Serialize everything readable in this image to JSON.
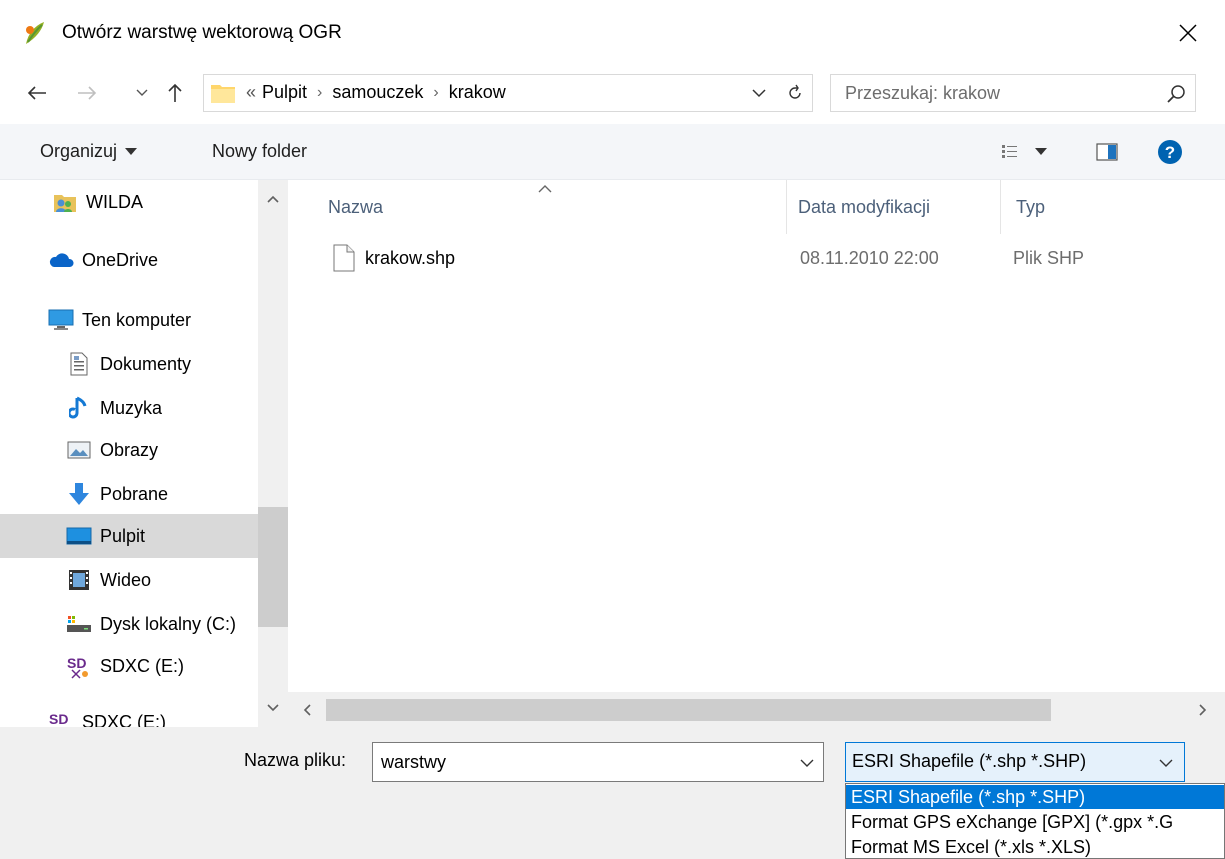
{
  "window": {
    "title": "Otwórz warstwę wektorową OGR",
    "close_icon": "close-icon"
  },
  "nav": {
    "back_icon": "back-arrow-icon",
    "forward_icon": "forward-arrow-icon",
    "recent_icon": "chevron-down-icon",
    "up_icon": "up-arrow-icon",
    "overflow": "«",
    "breadcrumbs": [
      "Pulpit",
      "samouczek",
      "krakow"
    ],
    "refresh_icon": "refresh-icon",
    "search_placeholder": "Przeszukaj: krakow"
  },
  "toolbar": {
    "organize_label": "Organizuj",
    "new_folder_label": "Nowy folder",
    "view_icon": "view-options-icon",
    "preview_icon": "preview-pane-icon",
    "help_icon": "help-icon"
  },
  "sidebar": {
    "items": [
      {
        "label": "WILDA",
        "icon": "user-folder-icon"
      },
      {
        "label": "OneDrive",
        "icon": "cloud-icon"
      },
      {
        "label": "Ten komputer",
        "icon": "computer-icon"
      },
      {
        "label": "Dokumenty",
        "icon": "documents-icon"
      },
      {
        "label": "Muzyka",
        "icon": "music-icon"
      },
      {
        "label": "Obrazy",
        "icon": "pictures-icon"
      },
      {
        "label": "Pobrane",
        "icon": "download-icon"
      },
      {
        "label": "Pulpit",
        "icon": "desktop-icon",
        "selected": true
      },
      {
        "label": "Wideo",
        "icon": "video-icon"
      },
      {
        "label": "Dysk lokalny (C:)",
        "icon": "drive-icon"
      },
      {
        "label": "SDXC (E:)",
        "icon": "sd-card-icon"
      },
      {
        "label": "SDXC (E:)",
        "icon": "sd-card-icon"
      }
    ]
  },
  "file_list": {
    "columns": [
      "Nazwa",
      "Data modyfikacji",
      "Typ"
    ],
    "rows": [
      {
        "name": "krakow.shp",
        "modified": "08.11.2010 22:00",
        "type": "Plik SHP"
      }
    ]
  },
  "footer": {
    "filename_label": "Nazwa pliku:",
    "filename_value": "warstwy",
    "filter_selected": "ESRI Shapefile (*.shp *.SHP)",
    "filter_options": [
      "ESRI Shapefile (*.shp *.SHP)",
      "Format GPS eXchange [GPX] (*.gpx *.G",
      "Format MS Excel (*.xls *.XLS)"
    ]
  },
  "colors": {
    "accent": "#0078d7",
    "selection_bg": "#d9d9d9",
    "toolbar_bg": "#f4f6f9",
    "footer_bg": "#f0f0f0"
  }
}
